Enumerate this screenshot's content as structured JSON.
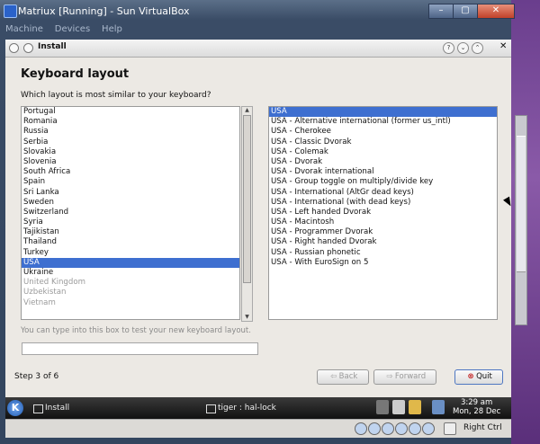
{
  "window": {
    "title": "Matriux [Running] - Sun VirtualBox",
    "menus": [
      "Machine",
      "Devices",
      "Help"
    ],
    "btn_min": "–",
    "btn_max": "▢",
    "btn_close": "✕"
  },
  "installer": {
    "title": "Install",
    "heading": "Keyboard layout",
    "question": "Which layout is most similar to your keyboard?",
    "countries": [
      "Portugal",
      "Romania",
      "Russia",
      "Serbia",
      "Slovakia",
      "Slovenia",
      "South Africa",
      "Spain",
      "Sri Lanka",
      "Sweden",
      "Switzerland",
      "Syria",
      "Tajikistan",
      "Thailand",
      "Turkey",
      "USA",
      "Ukraine",
      "United Kingdom",
      "Uzbekistan",
      "Vietnam"
    ],
    "selected_country": "USA",
    "variants": [
      "USA",
      "USA - Alternative international (former us_intl)",
      "USA - Cherokee",
      "USA - Classic Dvorak",
      "USA - Colemak",
      "USA - Dvorak",
      "USA - Dvorak international",
      "USA - Group toggle on multiply/divide key",
      "USA - International (AltGr dead keys)",
      "USA - International (with dead keys)",
      "USA - Left handed Dvorak",
      "USA - Macintosh",
      "USA - Programmer Dvorak",
      "USA - Right handed Dvorak",
      "USA - Russian phonetic",
      "USA - With EuroSign on 5"
    ],
    "selected_variant": "USA",
    "test_hint": "You can type into this box to test your new keyboard layout.",
    "test_value": "",
    "step": "Step 3 of 6",
    "back_label": "Back",
    "forward_label": "Forward",
    "quit_label": "Quit"
  },
  "taskbar": {
    "kmenu_label": "K",
    "tasks": [
      "Install",
      "tiger : hal-lock"
    ],
    "time": "3:29 am",
    "date": "Mon, 28 Dec"
  },
  "statusbar": {
    "host_key": "Right Ctrl"
  },
  "colors": {
    "selection": "#3e6fd0",
    "quit_icon": "#c21f1f",
    "title_bar": "#3a4c66"
  }
}
